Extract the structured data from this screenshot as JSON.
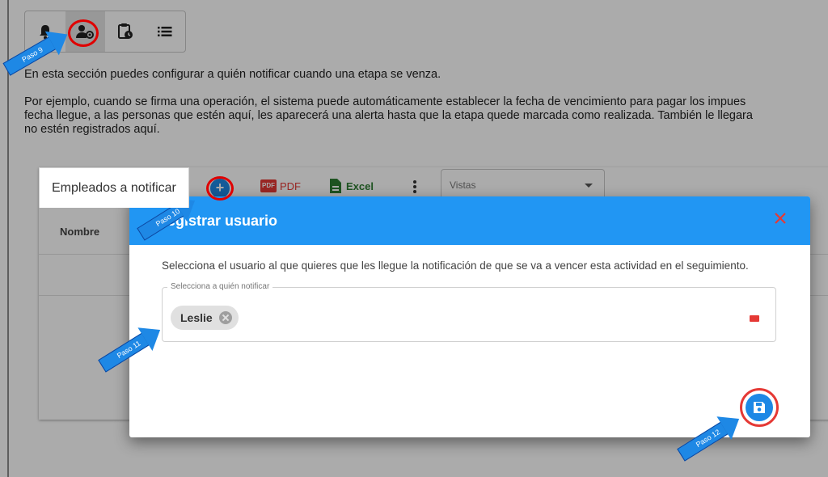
{
  "toolbar": {
    "tabs": [
      {
        "icon": "bell-icon"
      },
      {
        "icon": "user-settings-icon"
      },
      {
        "icon": "clipboard-clock-icon"
      },
      {
        "icon": "list-icon"
      }
    ]
  },
  "content": {
    "intro": "En esta sección puedes configurar a quién notificar cuando una etapa se venza.",
    "desc_line1": "Por ejemplo, cuando se firma una operación, el sistema puede automáticamente establecer la fecha de vencimiento para pagar los impues",
    "desc_line2": "fecha llegue, a las personas que estén aquí, les aparecerá una alerta hasta que la etapa quede marcada como realizada. También le llegara",
    "desc_line3": "no estén registrados aquí."
  },
  "card": {
    "tab_label": "Empleados a notificar",
    "pdf_label": "PDF",
    "pdf_icon_text": "PDF",
    "excel_label": "Excel",
    "views_placeholder": "Vistas",
    "column_name": "Nombre"
  },
  "dialog": {
    "title": "Registrar usuario",
    "description": "Selecciona el usuario al que quieres que les llegue la notificación de que se va a vencer esta actividad en el seguimiento.",
    "field_label": "Selecciona a quién notificar",
    "selected_chip": "Leslie"
  },
  "annotations": {
    "step9": "Paso 9",
    "step10": "Paso 10",
    "step11": "Paso 11",
    "step12": "Paso 12"
  },
  "colors": {
    "primary": "#2196f3",
    "danger": "#e53935",
    "excel": "#2e7d32"
  }
}
